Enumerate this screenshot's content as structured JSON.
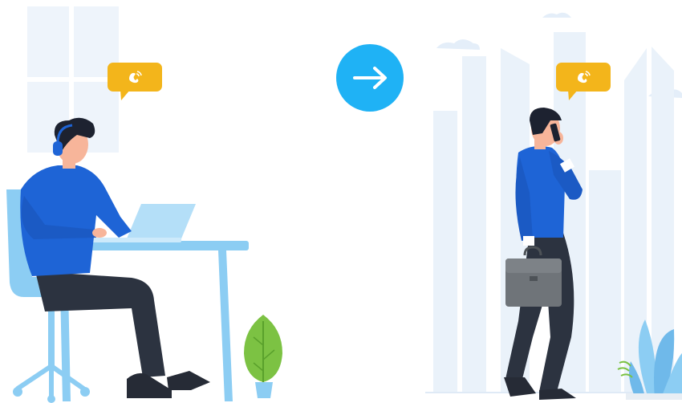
{
  "scene": {
    "description_free": true,
    "left_panel": {
      "speech_bubble_icon": "phone-ringing-icon"
    },
    "center": {
      "arrow_icon": "arrow-right-icon"
    },
    "right_panel": {
      "speech_bubble_icon": "phone-ringing-icon"
    }
  },
  "colors": {
    "accent_blue": "#1fb2f5",
    "bubble_yellow": "#f3b51b",
    "shirt_blue": "#1e64d6",
    "pants_dark": "#2c3340",
    "skin": "#f7b59a",
    "hair": "#1d2230",
    "furniture_light_blue": "#8ccdf3",
    "window_bg": "#eef4fb",
    "city_bg": "#eaf2fa",
    "plant_green": "#7cc243",
    "briefcase_gray": "#6f7479"
  }
}
